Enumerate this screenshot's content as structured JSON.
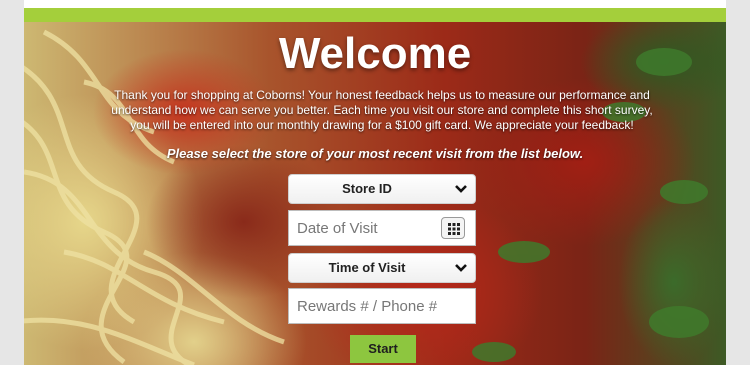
{
  "header": {
    "accent_color": "#a4cf3b"
  },
  "hero": {
    "image": "spaghetti-with-tomato-sauce-and-parsley",
    "title": "Welcome",
    "intro": "Thank you for shopping at Coborns! Your honest feedback helps us to measure our performance and understand how we can serve you better. Each time you visit our store and complete this short survey, you will be entered into our monthly drawing for a $100 gift card. We appreciate your feedback!",
    "prompt": "Please select the store of your most recent visit from the list below."
  },
  "form": {
    "store_select": {
      "selected": "Store ID",
      "icon": "chevron-down-icon"
    },
    "date_field": {
      "placeholder": "Date of Visit",
      "icon": "calendar-icon"
    },
    "time_select": {
      "selected": "Time of Visit",
      "icon": "chevron-down-icon"
    },
    "rewards_field": {
      "placeholder": "Rewards # / Phone #"
    },
    "start_label": "Start",
    "start_color": "#8dc63f"
  }
}
